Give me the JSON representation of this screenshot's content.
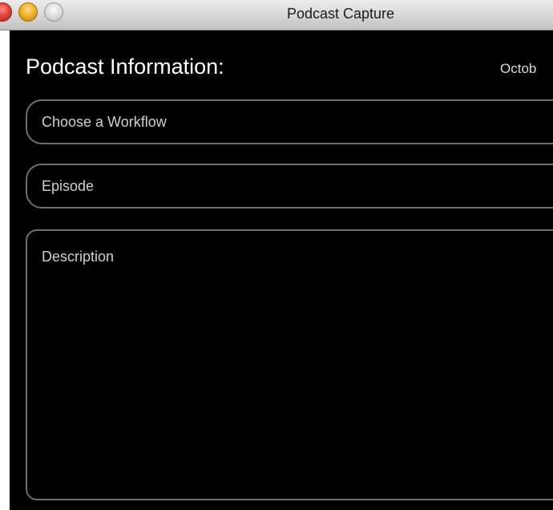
{
  "window": {
    "title": "Podcast Capture"
  },
  "podcast_info": {
    "heading": "Podcast Information:",
    "date": "Octob"
  },
  "fields": {
    "workflow_placeholder": "Choose a Workflow",
    "episode_placeholder": "Episode",
    "description_placeholder": "Description"
  }
}
